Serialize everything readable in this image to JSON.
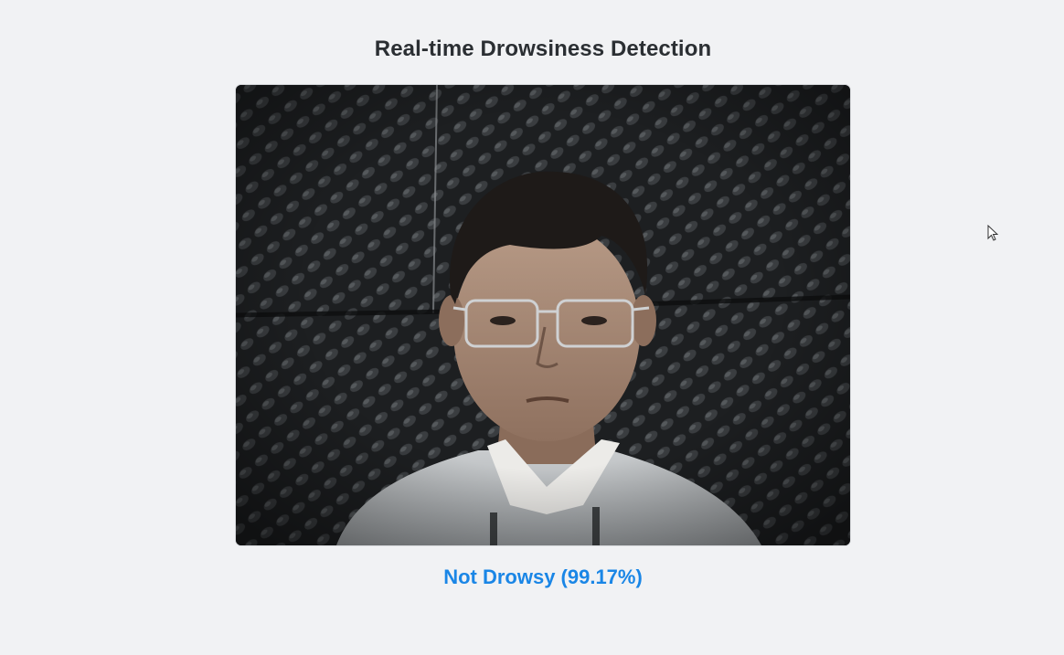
{
  "header": {
    "title": "Real-time Drowsiness Detection"
  },
  "video": {
    "icon": "webcam-feed"
  },
  "status": {
    "label": "Not Drowsy (99.17%)",
    "color": "#1a86e6"
  },
  "colors": {
    "background": "#f1f2f4",
    "title": "#2b2f33"
  }
}
